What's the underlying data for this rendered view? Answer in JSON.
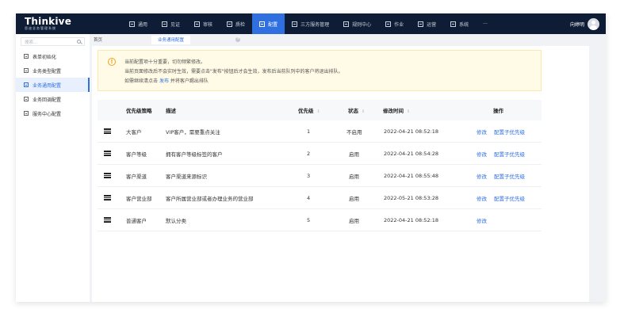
{
  "brand": {
    "name": "Thinkive",
    "subtitle": "思迪业务管理系统"
  },
  "nav": [
    {
      "label": "通用",
      "icon": "doc-icon"
    },
    {
      "label": "见证",
      "icon": "doc-icon"
    },
    {
      "label": "审核",
      "icon": "doc-icon"
    },
    {
      "label": "质检",
      "icon": "doc-icon"
    },
    {
      "label": "配置",
      "icon": "doc-icon",
      "active": true
    },
    {
      "label": "三方服务管理",
      "icon": "doc-icon"
    },
    {
      "label": "规则中心",
      "icon": "doc-icon"
    },
    {
      "label": "作业",
      "icon": "doc-icon"
    },
    {
      "label": "运营",
      "icon": "people-icon"
    },
    {
      "label": "系统",
      "icon": "doc-icon"
    },
    {
      "label": "···"
    }
  ],
  "user": {
    "name": "向婷明"
  },
  "sidebar": {
    "search_placeholder": "搜索...",
    "items": [
      {
        "label": "表单初始化"
      },
      {
        "label": "业务类型配置"
      },
      {
        "label": "业务通用配置",
        "active": true
      },
      {
        "label": "业务回调配置"
      },
      {
        "label": "服务中心配置"
      }
    ]
  },
  "tabs": [
    {
      "label": "首页"
    },
    {
      "label": "业务通用配置",
      "active": true
    }
  ],
  "alert": {
    "line1": "当前配置项十分重要，切勿频繁修改。",
    "line2": "当前页面修改后不会实时生效，需要点击\"发布\"按钮后才会生效，发布后当前队列中的客户将退出排队。",
    "line3_prefix": "如需继续清点击",
    "line3_link": "发布",
    "line3_suffix": "并将客户踢出排队"
  },
  "table": {
    "headers": {
      "strategy": "优先级策略",
      "desc": "描述",
      "priority": "优先级",
      "status": "状态",
      "time": "修改时间",
      "ops": "操作"
    },
    "sort_glyph": "⇕",
    "rows": [
      {
        "strategy": "大客户",
        "desc": "VIP客户，需要重点关注",
        "priority": "1",
        "status": "不启用",
        "time": "2022-04-21  08:52:18",
        "op1": "修改",
        "op2": "配置子优先级"
      },
      {
        "strategy": "客户等级",
        "desc": "拥有客户等级标签的客户",
        "priority": "2",
        "status": "启用",
        "time": "2022-04-21  08:54:28",
        "op1": "修改",
        "op2": "配置子优先级"
      },
      {
        "strategy": "客户渠道",
        "desc": "客户渠道来源标识",
        "priority": "3",
        "status": "启用",
        "time": "2022-04-21  08:55:48",
        "op1": "修改",
        "op2": "配置子优先级"
      },
      {
        "strategy": "客户营业部",
        "desc": "客户所属营业部或者办理业务的营业部",
        "priority": "4",
        "status": "启用",
        "time": "2022-05-21  08:53:28",
        "op1": "修改",
        "op2": "配置子优先级"
      },
      {
        "strategy": "普通客户",
        "desc": "默认分类",
        "priority": "5",
        "status": "启用",
        "time": "2022-04-21  08:52:18",
        "op1": "修改",
        "op2": ""
      }
    ]
  },
  "colors": {
    "accent": "#2f6fe0",
    "topbar": "#0e1d35",
    "warning": "#f0a020"
  }
}
